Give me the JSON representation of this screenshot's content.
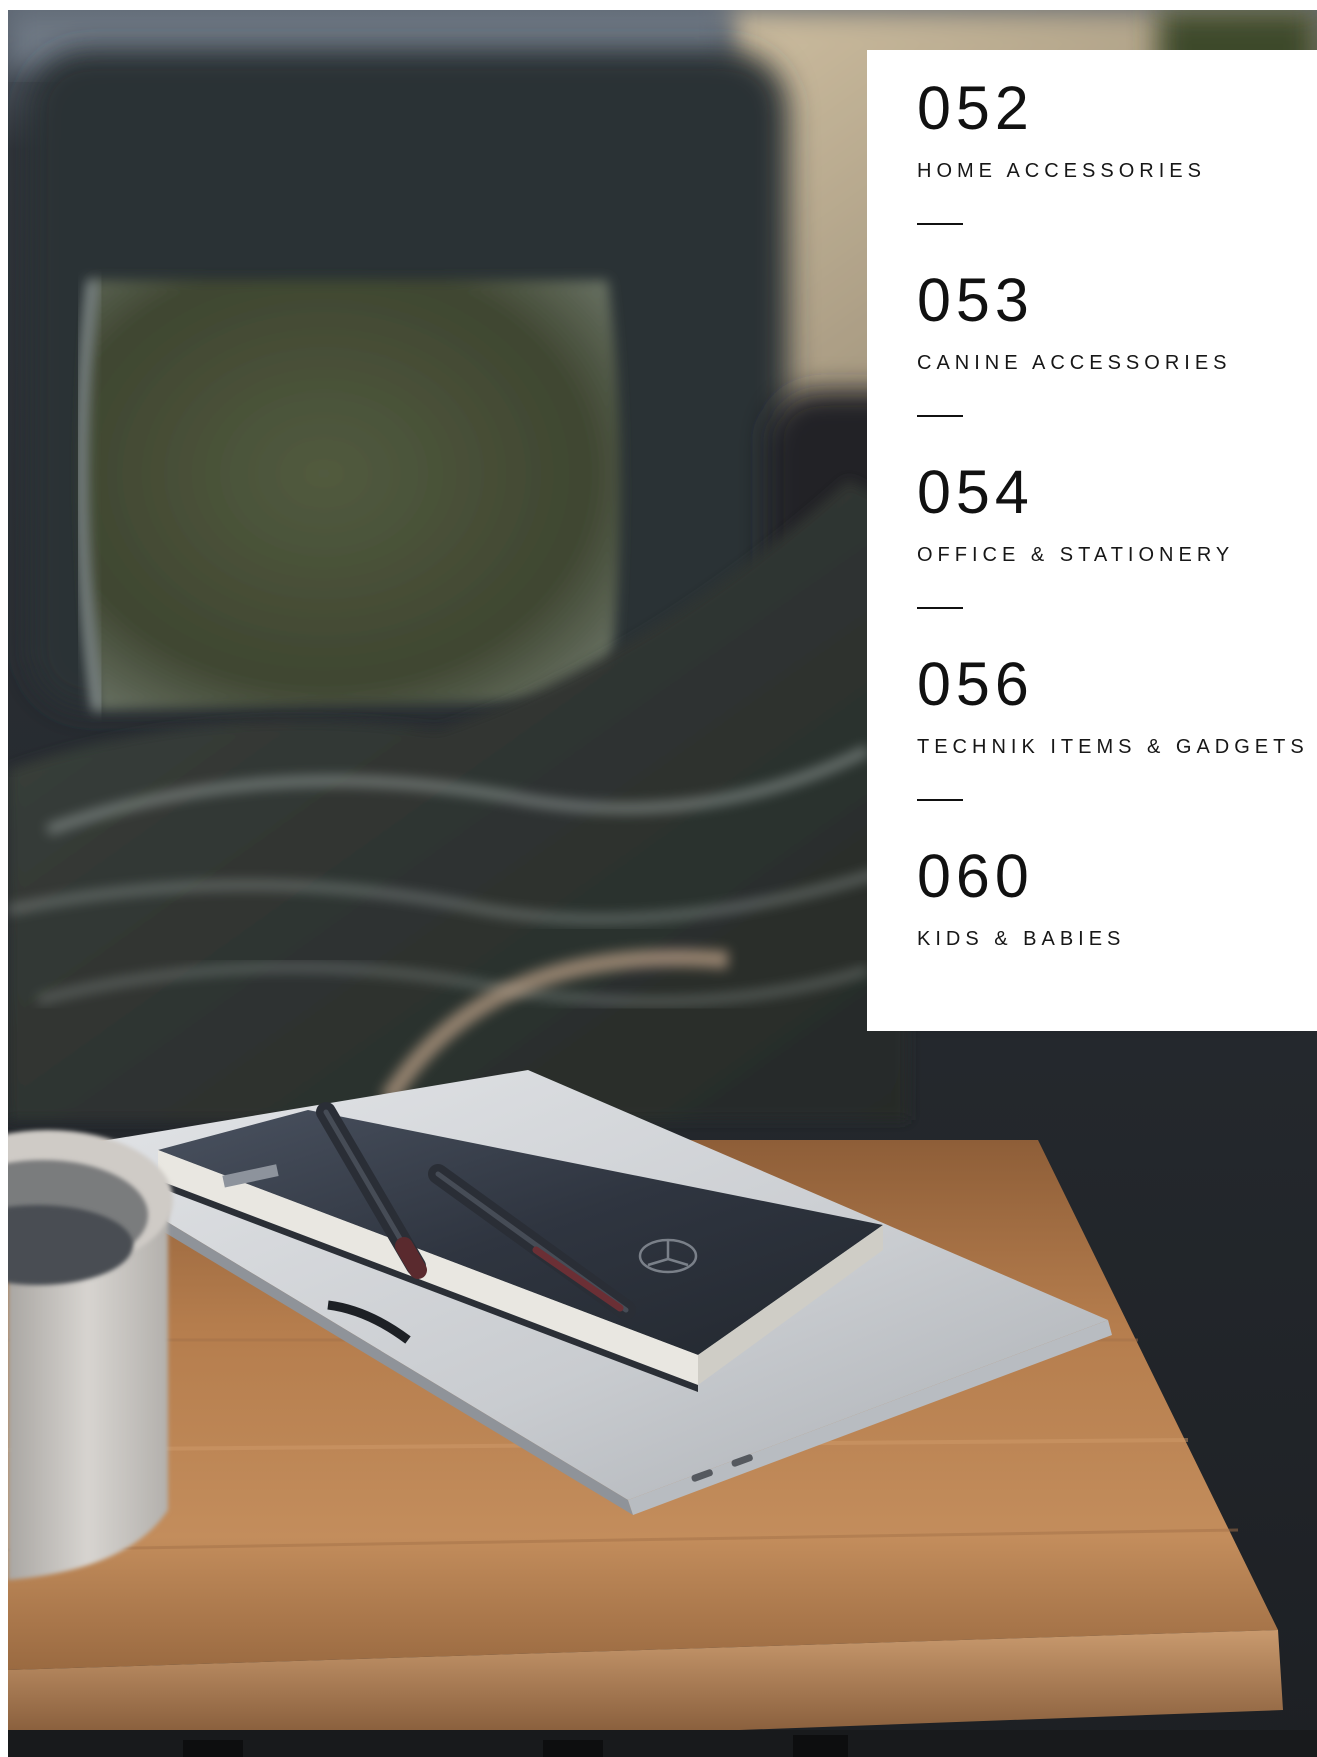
{
  "index": {
    "entries": [
      {
        "number": "052",
        "title": "HOME ACCESSORIES"
      },
      {
        "number": "053",
        "title": "CANINE ACCESSORIES"
      },
      {
        "number": "054",
        "title": "OFFICE & STATIONERY"
      },
      {
        "number": "056",
        "title": "TECHNIK ITEMS & GADGETS"
      },
      {
        "number": "060",
        "title": "KIDS & BABIES"
      }
    ]
  },
  "colors": {
    "panel_background": "#ffffff",
    "text": "#111111",
    "sofa": "#2a2d31",
    "wood_table": "#b57d4d",
    "notebook": "#2f3540"
  }
}
